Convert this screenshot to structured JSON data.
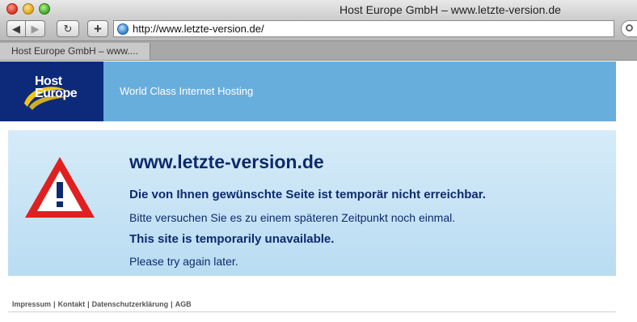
{
  "window": {
    "title": "Host Europe GmbH – www.letzte-version.de"
  },
  "toolbar": {
    "back_icon": "back-arrow-icon",
    "forward_icon": "forward-arrow-icon",
    "reload_icon": "reload-icon",
    "add_icon": "plus-icon",
    "url": "http://www.letzte-version.de/"
  },
  "tabs": [
    {
      "label": "Host Europe GmbH – www...."
    }
  ],
  "header": {
    "logo_host": "Host",
    "logo_europe": "Europe",
    "tagline": "World Class Internet Hosting"
  },
  "notice": {
    "domain": "www.letzte-version.de",
    "message_de_bold": "Die von Ihnen gewünschte Seite ist temporär nicht erreichbar.",
    "message_de": "Bitte versuchen Sie es zu einem späteren Zeitpunkt noch einmal.",
    "message_en_bold": "This site is temporarily unavailable.",
    "message_en": "Please try again later."
  },
  "footer": {
    "links": [
      "Impressum",
      "Kontakt",
      "Datenschutzerklärung",
      "AGB"
    ],
    "separator": "|"
  },
  "colors": {
    "header_bg": "#68aedd",
    "logo_bg": "#0d2a7a",
    "notice_text": "#0d2a6e",
    "warning_red": "#e02020"
  }
}
